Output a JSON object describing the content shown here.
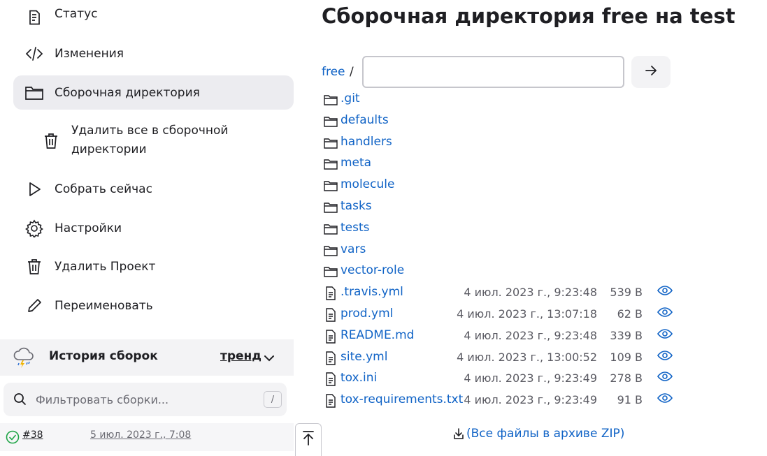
{
  "sidebar": {
    "items": [
      {
        "label": "Статус",
        "icon": "document-icon"
      },
      {
        "label": "Изменения",
        "icon": "code-icon"
      },
      {
        "label": "Сборочная директория",
        "icon": "folder-icon",
        "active": true
      },
      {
        "label": "Удалить все в сборочной директории",
        "icon": "trash-icon"
      },
      {
        "label": "Собрать сейчас",
        "icon": "play-icon"
      },
      {
        "label": "Настройки",
        "icon": "gear-icon"
      },
      {
        "label": "Удалить Проект",
        "icon": "trash-icon"
      },
      {
        "label": "Переименовать",
        "icon": "pencil-icon"
      }
    ],
    "history": {
      "title": "История сборок",
      "trend_label": "тренд",
      "filter_placeholder": "Фильтровать сборки...",
      "filter_shortcut": "/",
      "builds": [
        {
          "number": "#38",
          "date": "5 июл. 2023 г., 7:08",
          "status": "success"
        }
      ]
    }
  },
  "main": {
    "title": "Сборочная директория free на test",
    "breadcrumb": "free",
    "separator": "/",
    "path_input_value": "",
    "go_button_icon": "arrow-right-icon",
    "folders": [
      ".git",
      "defaults",
      "handlers",
      "meta",
      "molecule",
      "tasks",
      "tests",
      "vars",
      "vector-role"
    ],
    "files": [
      {
        "name": ".travis.yml",
        "date": "4 июл. 2023 г., 9:23:48",
        "size": "539 B"
      },
      {
        "name": "prod.yml",
        "date": "4 июл. 2023 г., 13:07:18",
        "size": "62 B"
      },
      {
        "name": "README.md",
        "date": "4 июл. 2023 г., 9:23:48",
        "size": "339 B"
      },
      {
        "name": "site.yml",
        "date": "4 июл. 2023 г., 13:00:52",
        "size": "109 B"
      },
      {
        "name": "tox.ini",
        "date": "4 июл. 2023 г., 9:23:49",
        "size": "278 B"
      },
      {
        "name": "tox-requirements.txt",
        "date": "4 июл. 2023 г., 9:23:49",
        "size": "91 B"
      }
    ],
    "zip_link": "(Все файлы в архиве ZIP)"
  },
  "colors": {
    "link": "#1063c6",
    "active_bg": "#ececf0",
    "success": "#1ea446"
  }
}
